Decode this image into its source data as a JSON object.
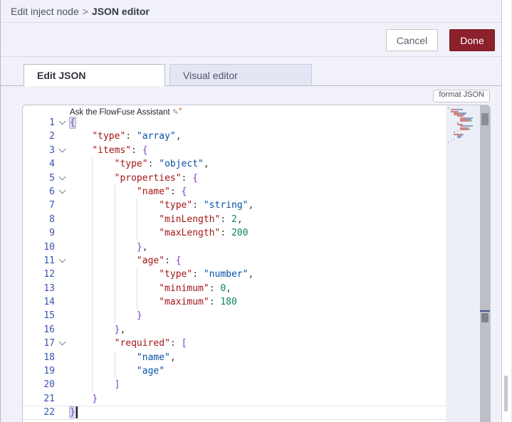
{
  "header": {
    "breadcrumb_prefix": "Edit inject node",
    "breadcrumb_sep": ">",
    "breadcrumb_current": "JSON editor"
  },
  "toolbar": {
    "cancel_label": "Cancel",
    "done_label": "Done"
  },
  "tabs": [
    {
      "label": "Edit JSON",
      "active": true
    },
    {
      "label": "Visual editor",
      "active": false
    }
  ],
  "format_button_label": "format JSON",
  "assistant": {
    "hint": "Ask the FlowFuse Assistant",
    "icon": "pencil-sparkle-icon"
  },
  "colors": {
    "done_button": "#8c202c",
    "panel_bg": "#f1f2f9",
    "token_key": "#a31515",
    "token_string": "#0451a5",
    "token_number": "#098658",
    "token_punct": "#3b3b3b",
    "token_brace": "#7b3fc4",
    "line_number": "#3a54b0"
  },
  "editor": {
    "language": "json",
    "line_count": 22,
    "cursor_line": 22,
    "lines": [
      {
        "n": 1,
        "fold": true,
        "indent": 0,
        "tokens": [
          {
            "t": "{",
            "c": "brc",
            "match": true
          }
        ]
      },
      {
        "n": 2,
        "fold": false,
        "indent": 1,
        "tokens": [
          {
            "t": "    ",
            "c": "pln"
          },
          {
            "t": "\"type\"",
            "c": "key"
          },
          {
            "t": ": ",
            "c": "pun"
          },
          {
            "t": "\"array\"",
            "c": "str"
          },
          {
            "t": ",",
            "c": "pun"
          }
        ]
      },
      {
        "n": 3,
        "fold": true,
        "indent": 1,
        "tokens": [
          {
            "t": "    ",
            "c": "pln"
          },
          {
            "t": "\"items\"",
            "c": "key"
          },
          {
            "t": ": ",
            "c": "pun"
          },
          {
            "t": "{",
            "c": "brc"
          }
        ]
      },
      {
        "n": 4,
        "fold": false,
        "indent": 2,
        "tokens": [
          {
            "t": "        ",
            "c": "pln"
          },
          {
            "t": "\"type\"",
            "c": "key"
          },
          {
            "t": ": ",
            "c": "pun"
          },
          {
            "t": "\"object\"",
            "c": "str"
          },
          {
            "t": ",",
            "c": "pun"
          }
        ]
      },
      {
        "n": 5,
        "fold": true,
        "indent": 2,
        "tokens": [
          {
            "t": "        ",
            "c": "pln"
          },
          {
            "t": "\"properties\"",
            "c": "key"
          },
          {
            "t": ": ",
            "c": "pun"
          },
          {
            "t": "{",
            "c": "brc"
          }
        ]
      },
      {
        "n": 6,
        "fold": true,
        "indent": 3,
        "tokens": [
          {
            "t": "            ",
            "c": "pln"
          },
          {
            "t": "\"name\"",
            "c": "key"
          },
          {
            "t": ": ",
            "c": "pun"
          },
          {
            "t": "{",
            "c": "brc"
          }
        ]
      },
      {
        "n": 7,
        "fold": false,
        "indent": 4,
        "tokens": [
          {
            "t": "                ",
            "c": "pln"
          },
          {
            "t": "\"type\"",
            "c": "key"
          },
          {
            "t": ": ",
            "c": "pun"
          },
          {
            "t": "\"string\"",
            "c": "str"
          },
          {
            "t": ",",
            "c": "pun"
          }
        ]
      },
      {
        "n": 8,
        "fold": false,
        "indent": 4,
        "tokens": [
          {
            "t": "                ",
            "c": "pln"
          },
          {
            "t": "\"minLength\"",
            "c": "key"
          },
          {
            "t": ": ",
            "c": "pun"
          },
          {
            "t": "2",
            "c": "num"
          },
          {
            "t": ",",
            "c": "pun"
          }
        ]
      },
      {
        "n": 9,
        "fold": false,
        "indent": 4,
        "tokens": [
          {
            "t": "                ",
            "c": "pln"
          },
          {
            "t": "\"maxLength\"",
            "c": "key"
          },
          {
            "t": ": ",
            "c": "pun"
          },
          {
            "t": "200",
            "c": "num"
          }
        ]
      },
      {
        "n": 10,
        "fold": false,
        "indent": 3,
        "tokens": [
          {
            "t": "            ",
            "c": "pln"
          },
          {
            "t": "}",
            "c": "brc"
          },
          {
            "t": ",",
            "c": "pun"
          }
        ]
      },
      {
        "n": 11,
        "fold": true,
        "indent": 3,
        "tokens": [
          {
            "t": "            ",
            "c": "pln"
          },
          {
            "t": "\"age\"",
            "c": "key"
          },
          {
            "t": ": ",
            "c": "pun"
          },
          {
            "t": "{",
            "c": "brc"
          }
        ]
      },
      {
        "n": 12,
        "fold": false,
        "indent": 4,
        "tokens": [
          {
            "t": "                ",
            "c": "pln"
          },
          {
            "t": "\"type\"",
            "c": "key"
          },
          {
            "t": ": ",
            "c": "pun"
          },
          {
            "t": "\"number\"",
            "c": "str"
          },
          {
            "t": ",",
            "c": "pun"
          }
        ]
      },
      {
        "n": 13,
        "fold": false,
        "indent": 4,
        "tokens": [
          {
            "t": "                ",
            "c": "pln"
          },
          {
            "t": "\"minimum\"",
            "c": "key"
          },
          {
            "t": ": ",
            "c": "pun"
          },
          {
            "t": "0",
            "c": "num"
          },
          {
            "t": ",",
            "c": "pun"
          }
        ]
      },
      {
        "n": 14,
        "fold": false,
        "indent": 4,
        "tokens": [
          {
            "t": "                ",
            "c": "pln"
          },
          {
            "t": "\"maximum\"",
            "c": "key"
          },
          {
            "t": ": ",
            "c": "pun"
          },
          {
            "t": "180",
            "c": "num"
          }
        ]
      },
      {
        "n": 15,
        "fold": false,
        "indent": 3,
        "tokens": [
          {
            "t": "            ",
            "c": "pln"
          },
          {
            "t": "}",
            "c": "brc"
          }
        ]
      },
      {
        "n": 16,
        "fold": false,
        "indent": 2,
        "tokens": [
          {
            "t": "        ",
            "c": "pln"
          },
          {
            "t": "}",
            "c": "brc"
          },
          {
            "t": ",",
            "c": "pun"
          }
        ]
      },
      {
        "n": 17,
        "fold": true,
        "indent": 2,
        "tokens": [
          {
            "t": "        ",
            "c": "pln"
          },
          {
            "t": "\"required\"",
            "c": "key"
          },
          {
            "t": ": ",
            "c": "pun"
          },
          {
            "t": "[",
            "c": "brc"
          }
        ]
      },
      {
        "n": 18,
        "fold": false,
        "indent": 3,
        "tokens": [
          {
            "t": "            ",
            "c": "pln"
          },
          {
            "t": "\"name\"",
            "c": "str"
          },
          {
            "t": ",",
            "c": "pun"
          }
        ]
      },
      {
        "n": 19,
        "fold": false,
        "indent": 3,
        "tokens": [
          {
            "t": "            ",
            "c": "pln"
          },
          {
            "t": "\"age\"",
            "c": "str"
          }
        ]
      },
      {
        "n": 20,
        "fold": false,
        "indent": 2,
        "tokens": [
          {
            "t": "        ",
            "c": "pln"
          },
          {
            "t": "]",
            "c": "brc"
          }
        ]
      },
      {
        "n": 21,
        "fold": false,
        "indent": 1,
        "tokens": [
          {
            "t": "    ",
            "c": "pln"
          },
          {
            "t": "}",
            "c": "brc"
          }
        ]
      },
      {
        "n": 22,
        "fold": false,
        "indent": 0,
        "current": true,
        "cursor": true,
        "tokens": [
          {
            "t": "}",
            "c": "brc",
            "match": true
          }
        ]
      }
    ]
  }
}
